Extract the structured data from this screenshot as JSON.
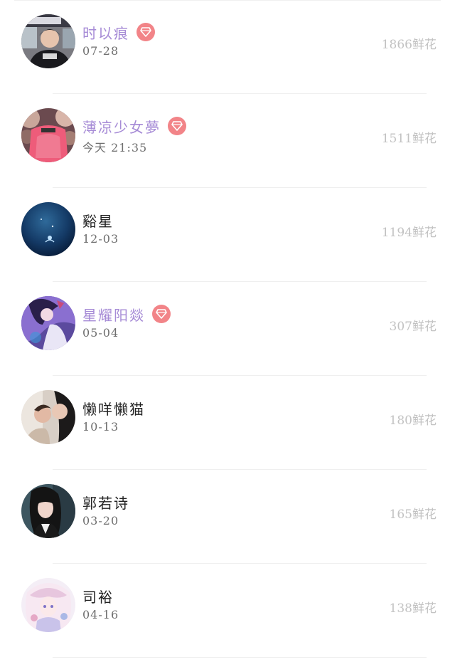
{
  "colors": {
    "vip_name": "#a68bd6",
    "normal_name": "#222222",
    "badge_bg": "#f28488",
    "date_text": "#6e6e6e",
    "flower_text": "#c2c2c2",
    "divider": "#efefef"
  },
  "rows": [
    {
      "name": "时以痕",
      "vip": true,
      "date": "07-28",
      "flowers": "1866鲜花",
      "avatar_icon": "boy-photo-avatar",
      "badge_icon": "diamond-icon"
    },
    {
      "name": "薄凉少女夢",
      "vip": true,
      "date": "今天 21:35",
      "flowers": "1511鲜花",
      "avatar_icon": "pink-photo-avatar",
      "badge_icon": "diamond-icon"
    },
    {
      "name": "谿星",
      "vip": false,
      "date": "12-03",
      "flowers": "1194鲜花",
      "avatar_icon": "ocean-photo-avatar"
    },
    {
      "name": "星耀阳燚",
      "vip": true,
      "date": "05-04",
      "flowers": "307鲜花",
      "avatar_icon": "anime-girl-avatar",
      "badge_icon": "diamond-icon"
    },
    {
      "name": "懒咩懒猫",
      "vip": false,
      "date": "10-13",
      "flowers": "180鲜花",
      "avatar_icon": "couple-photo-avatar"
    },
    {
      "name": "郭若诗",
      "vip": false,
      "date": "03-20",
      "flowers": "165鲜花",
      "avatar_icon": "girl-photo-avatar"
    },
    {
      "name": "司裕",
      "vip": false,
      "date": "04-16",
      "flowers": "138鲜花",
      "avatar_icon": "anime-white-hair-avatar"
    }
  ]
}
